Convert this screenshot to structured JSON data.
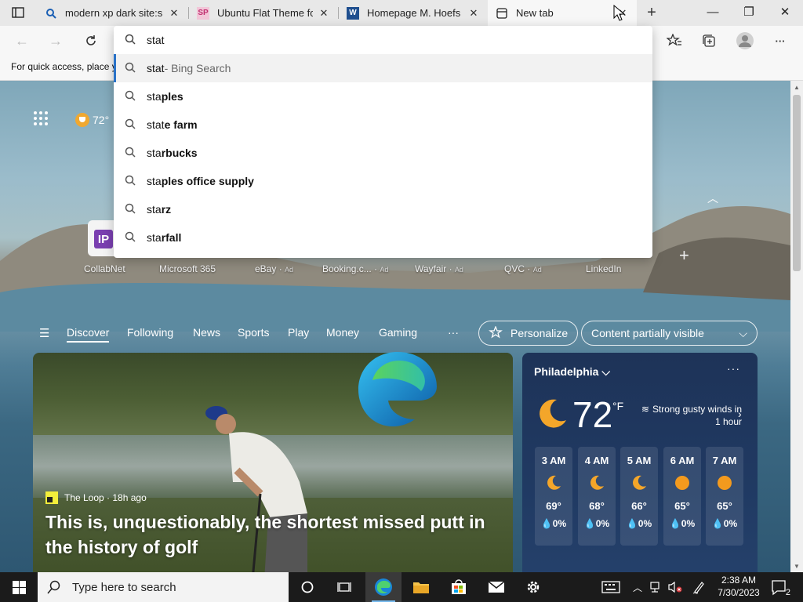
{
  "tabs": [
    {
      "title": "modern xp dark site:skin",
      "favicon": "search-icon",
      "active": false
    },
    {
      "title": "Ubuntu Flat Theme for W",
      "favicon": "sp-logo",
      "active": false
    },
    {
      "title": "Homepage M. Hoefs - W",
      "favicon": "wordpress-logo",
      "active": false
    },
    {
      "title": "New tab",
      "favicon": "newtab-icon",
      "active": true
    }
  ],
  "window": {
    "minimize": "—",
    "maximize": "❐",
    "close": "✕"
  },
  "favorites_bar": {
    "hint": "For quick access, place y"
  },
  "omnibox": {
    "value": "stat",
    "suggestions": [
      {
        "prefix": "stat",
        "suffix": "",
        "note": " - Bing Search",
        "highlight": true
      },
      {
        "prefix": "sta",
        "suffix": "ples",
        "note": ""
      },
      {
        "prefix": "stat",
        "suffix": "e farm",
        "note": ""
      },
      {
        "prefix": "sta",
        "suffix": "rbucks",
        "note": ""
      },
      {
        "prefix": "sta",
        "suffix": "ples office supply",
        "note": ""
      },
      {
        "prefix": "sta",
        "suffix": "rz",
        "note": ""
      },
      {
        "prefix": "sta",
        "suffix": "rfall",
        "note": ""
      }
    ]
  },
  "newtab": {
    "weather_mini": "72°",
    "quick_links": [
      {
        "label": "CollabNet",
        "ad": false
      },
      {
        "label": "Microsoft 365",
        "ad": false
      },
      {
        "label": "eBay",
        "ad": true
      },
      {
        "label": "Booking.c...",
        "ad": true
      },
      {
        "label": "Wayfair",
        "ad": true
      },
      {
        "label": "QVC",
        "ad": true
      },
      {
        "label": "LinkedIn",
        "ad": false
      }
    ],
    "ad_label": "Ad",
    "ip_tile": "IP",
    "feed_nav": [
      "Discover",
      "Following",
      "News",
      "Sports",
      "Play",
      "Money",
      "Gaming"
    ],
    "more": "···",
    "personalize": "Personalize",
    "content_visibility": "Content partially visible"
  },
  "story": {
    "source": "The Loop · 18h ago",
    "title": "This is, unquestionably, the shortest missed putt in the history of golf"
  },
  "weather": {
    "city": "Philadelphia",
    "temp": "72",
    "unit": "°F",
    "alert": "Strong gusty winds in 1 hour",
    "more": "···",
    "hours": [
      {
        "time": "3 AM",
        "temp": "69°",
        "precip": "0%",
        "icon": "moon-icon"
      },
      {
        "time": "4 AM",
        "temp": "68°",
        "precip": "0%",
        "icon": "moon-icon"
      },
      {
        "time": "5 AM",
        "temp": "66°",
        "precip": "0%",
        "icon": "moon-icon"
      },
      {
        "time": "6 AM",
        "temp": "65°",
        "precip": "0%",
        "icon": "sun-icon"
      },
      {
        "time": "7 AM",
        "temp": "65°",
        "precip": "0%",
        "icon": "sun-icon"
      }
    ]
  },
  "taskbar": {
    "search_placeholder": "Type here to search",
    "time": "2:38 AM",
    "date": "7/30/2023",
    "notifications": "2"
  },
  "colors": {
    "accent": "#2a72c8",
    "taskbar": "#1b1b1b",
    "weather_card": "#1e3358"
  }
}
